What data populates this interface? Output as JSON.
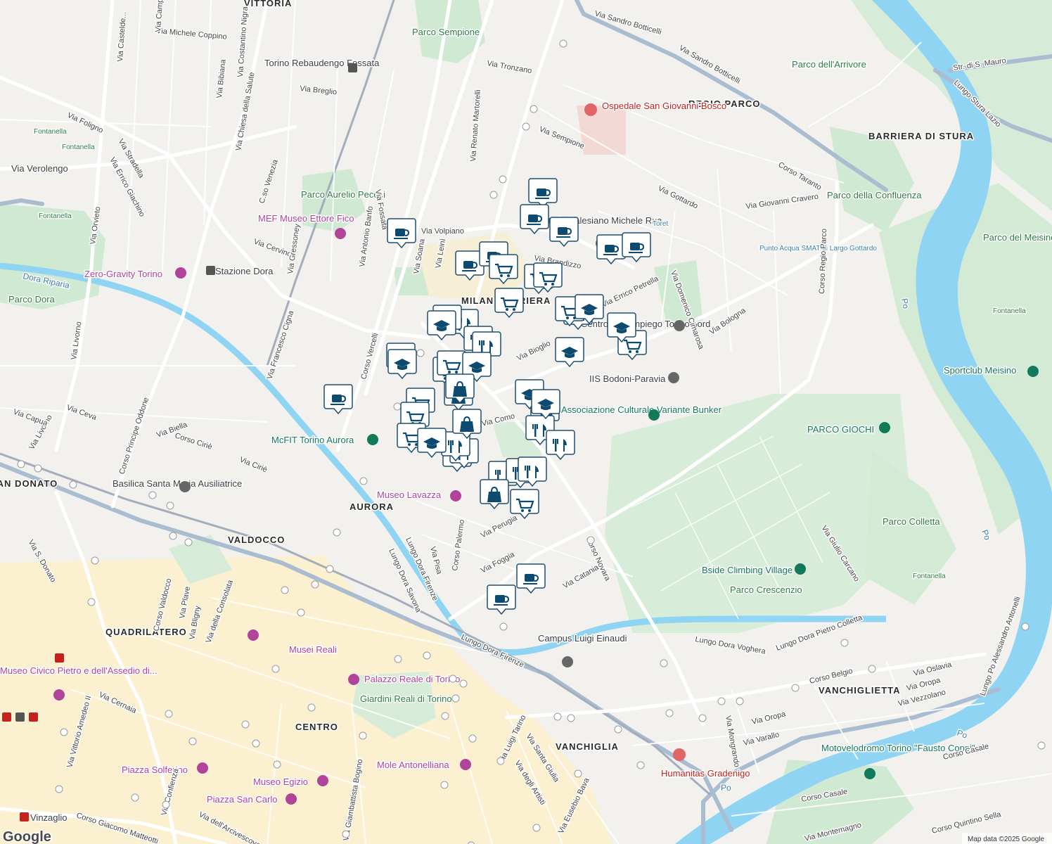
{
  "map": {
    "attribution": "Map data ©2025 Google",
    "logo_text": "Google",
    "colors": {
      "background": "#f2f1ee",
      "park": "#cde8d1",
      "water": "#8fd4f2",
      "river_dark": "#6fc6ea",
      "road_major": "#ffffff",
      "highway": "#8fa8c2",
      "rail": "#9aa5b5",
      "historic_center": "#fbecc0",
      "pin_fill": "#ffffff",
      "pin_icon": "#0d4a70"
    },
    "areas": [
      {
        "name": "VITTORIA"
      },
      {
        "name": "REGIO PARCO"
      },
      {
        "name": "BARRIERA DI STURA"
      },
      {
        "name": "MILAN BARRIERA"
      },
      {
        "name": "AURORA"
      },
      {
        "name": "VALDOCCO"
      },
      {
        "name": "QUADRILATERO"
      },
      {
        "name": "CENTRO"
      },
      {
        "name": "VANCHIGLIA"
      },
      {
        "name": "VANCHIGLIETTA"
      },
      {
        "name": "SAN DONATO"
      }
    ],
    "parks": [
      {
        "name": "Parco Sempione"
      },
      {
        "name": "Parco dell'Arrivore"
      },
      {
        "name": "Parco della Confluenza"
      },
      {
        "name": "Parco Aurelio Peccei"
      },
      {
        "name": "Parco Dora"
      },
      {
        "name": "Parco del Meisino"
      },
      {
        "name": "Parco Colletta"
      },
      {
        "name": "Parco Crescenzio"
      },
      {
        "name": "Giardini Reali di Torino"
      },
      {
        "name": "Fontanella"
      },
      {
        "name": "PARCO GIOCHI"
      }
    ],
    "pois": [
      {
        "name": "Ospedale San Giovanni Bosco",
        "kind": "hospital"
      },
      {
        "name": "Humanitas Gradenigo",
        "kind": "hospital"
      },
      {
        "name": "MEF Museo Ettore Fico",
        "kind": "museum"
      },
      {
        "name": "Zero-Gravity Torino",
        "kind": "museum"
      },
      {
        "name": "Museo Lavazza",
        "kind": "museum"
      },
      {
        "name": "Musei Reali",
        "kind": "museum"
      },
      {
        "name": "Palazzo Reale di Torino",
        "kind": "museum"
      },
      {
        "name": "Mole Antonelliana",
        "kind": "museum"
      },
      {
        "name": "Museo Egizio",
        "kind": "museum"
      },
      {
        "name": "Piazza Solferino",
        "kind": "museum"
      },
      {
        "name": "Piazza San Carlo",
        "kind": "museum"
      },
      {
        "name": "Museo Civico Pietro e dell'Assedio di...",
        "kind": "museum"
      },
      {
        "name": "Basilica Santa Maria Ausiliatrice",
        "kind": "church"
      },
      {
        "name": "McFIT Torino Aurora",
        "kind": "sport"
      },
      {
        "name": "Associazione Culturale Variante Bunker",
        "kind": "sport"
      },
      {
        "name": "Bside Climbing Village",
        "kind": "sport"
      },
      {
        "name": "Sportclub Meisino",
        "kind": "sport"
      },
      {
        "name": "Motovelodromo Torino \"Fausto Coppi\"",
        "kind": "sport"
      },
      {
        "name": "Campus Luigi Einaudi",
        "kind": "school"
      },
      {
        "name": "IIS Bodoni-Paravia",
        "kind": "school"
      },
      {
        "name": "Centro per l'impiego Torino nord",
        "kind": "office"
      },
      {
        "name": "Oratorio Salesiano Michele Rua",
        "kind": "church"
      },
      {
        "name": "Torino Rebaudengo Fossata",
        "kind": "transit"
      },
      {
        "name": "Stazione Dora",
        "kind": "transit"
      },
      {
        "name": "Vinzaglio",
        "kind": "metro"
      },
      {
        "name": "Punto Acqua SMAT di Largo Gottardo",
        "kind": "water"
      },
      {
        "name": "Toret",
        "kind": "water"
      }
    ],
    "streets": [
      "Via Sandro Botticelli",
      "Via Tronzano",
      "Via Sempione",
      "Via Gottardo",
      "Corso Taranto",
      "Via Giovanni Cravero",
      "Corso Regio Parco",
      "Via Bologna",
      "Corso Novara",
      "Corso Palermo",
      "Corso Vercelli",
      "Via Francesco Cigna",
      "Via Volpiano",
      "Via Brandizzo",
      "Via Bioglio",
      "Via Errico Petrella",
      "Via Domenico Cimarosa",
      "Via Como",
      "Via Perugia",
      "Via Foggia",
      "Via Catania",
      "Via Pisa",
      "Lungo Dora Firenze",
      "Lungo Dora Savona",
      "Lungo Dora Voghera",
      "Lungo Dora Pietro Colletta",
      "Corso Belgio",
      "Via Oslavia",
      "Via Oropa",
      "Via Vezzolano",
      "Via Varallo",
      "Via Mongrando",
      "Corso Casale",
      "Corso Quintino Sella",
      "Via Montemagno",
      "Lungo Po Alessandro Antonelli",
      "Via Giulio Carcano",
      "Lungo Stura Lazio",
      "Str. di S. Mauro",
      "Via Verolengo",
      "Via Foligno",
      "Via Stradella",
      "Via Orvieto",
      "Via Livorno",
      "Via Ceva",
      "Via Capua",
      "Corso Principe Oddone",
      "Via Biella",
      "Corso Ciriè",
      "Via Ciriè",
      "C.so Venezia",
      "Via Michele Coppino",
      "Via Costantino Nigra",
      "Via Bibiana",
      "Via Breglio",
      "Via Chiesa della Salute",
      "Via Cervino",
      "Via Gressoney",
      "Via Antonio Banfo",
      "Via Fossata",
      "Via Soana",
      "Via Leinì",
      "Via Renato Martorelli",
      "Corso Valdocco",
      "Via S. Donato",
      "Via Plave",
      "Via Bligny",
      "Via della Consolata",
      "Corso Giacomo Matteotti",
      "Via Cernaia",
      "Via Vittorio Amedeo II",
      "Via Confienza",
      "Via dell'Arcivescovado",
      "Via Giambattista Bogino",
      "Via Luigi Tarino",
      "Via Santa Giulia",
      "Via degli Artisti",
      "Via Eusebio Bava",
      "Via Errico Giachino",
      "Via Castelde...",
      "Via Campi..."
    ],
    "rivers": [
      "Po",
      "Dora Riparia"
    ],
    "marker_counts": {
      "cafe": 12,
      "grocery": 14,
      "restaurant": 12,
      "school": 9,
      "shopping": 4
    }
  }
}
